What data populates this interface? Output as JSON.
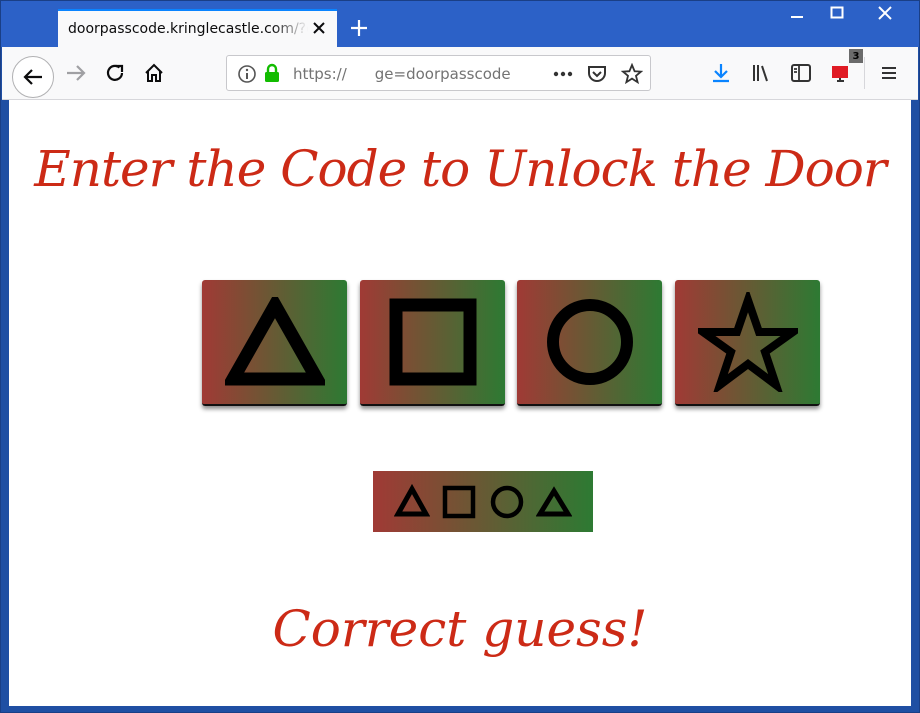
{
  "browser": {
    "tab_title": "doorpasscode.kringlecastle.com/?challenge=doorpasscode",
    "url_prefix": "https://",
    "url_suffix": "ge=doorpasscode",
    "notification_count": "3"
  },
  "page": {
    "heading": "Enter the Code to Unlock the Door",
    "buttons": [
      {
        "shape": "triangle",
        "icon": "triangle-icon"
      },
      {
        "shape": "square",
        "icon": "square-icon"
      },
      {
        "shape": "circle",
        "icon": "circle-icon"
      },
      {
        "shape": "star",
        "icon": "star-icon"
      }
    ],
    "entered_code": [
      "triangle",
      "square",
      "circle",
      "triangle"
    ],
    "result_text": "Correct guess!"
  },
  "colors": {
    "accent_red": "#cc2a16",
    "gradient_start": "#a03a35",
    "gradient_end": "#2d7a33",
    "download_blue": "#0a84ff",
    "lock_green": "#12bc00"
  }
}
